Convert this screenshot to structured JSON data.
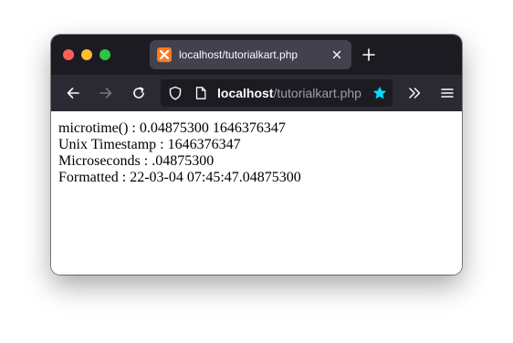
{
  "window": {
    "traffic_lights": [
      "close",
      "minimize",
      "zoom"
    ]
  },
  "tab": {
    "title": "localhost/tutorialkart.php",
    "favicon": "xampp-icon"
  },
  "navbar": {
    "url_host": "localhost",
    "url_path": "/tutorialkart.php",
    "bookmark_star_color": "#00ddff"
  },
  "content": {
    "lines": [
      "microtime() : 0.04875300 1646376347",
      "Unix Timestamp : 1646376347",
      "Microseconds : .04875300",
      "Formatted : 22-03-04 07:45:47.04875300"
    ]
  },
  "colors": {
    "titlebar": "#1c1b22",
    "tab_active": "#42414d",
    "toolbar": "#2b2a33",
    "urlbar": "#1c1b22"
  }
}
